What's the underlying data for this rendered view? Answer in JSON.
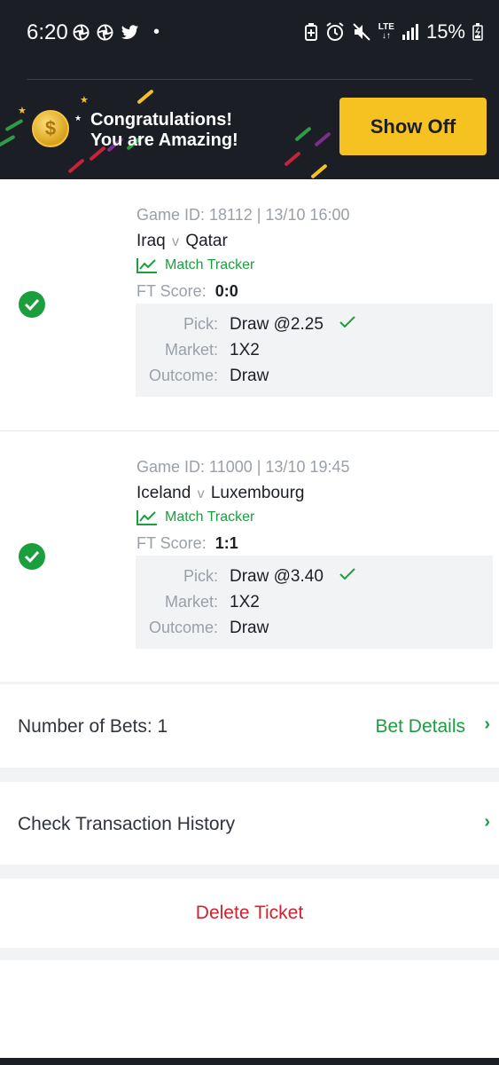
{
  "status_bar": {
    "time": "6:20",
    "dot": "•",
    "battery": "15%",
    "network": "LTE",
    "left_icons": [
      "aperture-icon",
      "aperture-icon",
      "twitter-icon"
    ],
    "right_icons": [
      "battery-saver-icon",
      "alarm-icon",
      "mute-icon",
      "lte-icon",
      "signal-icon",
      "battery-icon"
    ]
  },
  "banner": {
    "line1": "Congratulations!",
    "line2": "You are Amazing!",
    "button": "Show Off",
    "coin_symbol": "$"
  },
  "games": [
    {
      "game_id_line": "Game ID: 18112 | 13/10 16:00",
      "home": "Iraq",
      "vs": "v",
      "away": "Qatar",
      "tracker": "Match Tracker",
      "ft_label": "FT Score:",
      "ft_score": "0:0",
      "pick_label": "Pick:",
      "pick": "Draw @2.25",
      "market_label": "Market:",
      "market": "1X2",
      "outcome_label": "Outcome:",
      "outcome": "Draw"
    },
    {
      "game_id_line": "Game ID: 11000 | 13/10 19:45",
      "home": "Iceland",
      "vs": "v",
      "away": "Luxembourg",
      "tracker": "Match Tracker",
      "ft_label": "FT Score:",
      "ft_score": "1:1",
      "pick_label": "Pick:",
      "pick": "Draw @3.40",
      "market_label": "Market:",
      "market": "1X2",
      "outcome_label": "Outcome:",
      "outcome": "Draw"
    }
  ],
  "summary": {
    "number_of_bets": "Number of Bets: 1",
    "bet_details": "Bet Details",
    "chevron": "›",
    "transaction_history": "Check Transaction History",
    "delete_ticket": "Delete Ticket"
  },
  "colors": {
    "accent_green": "#1b9e3e",
    "banner_bg": "#1b1e25",
    "button_yellow": "#f6c221",
    "delete_red": "#d3202e"
  }
}
